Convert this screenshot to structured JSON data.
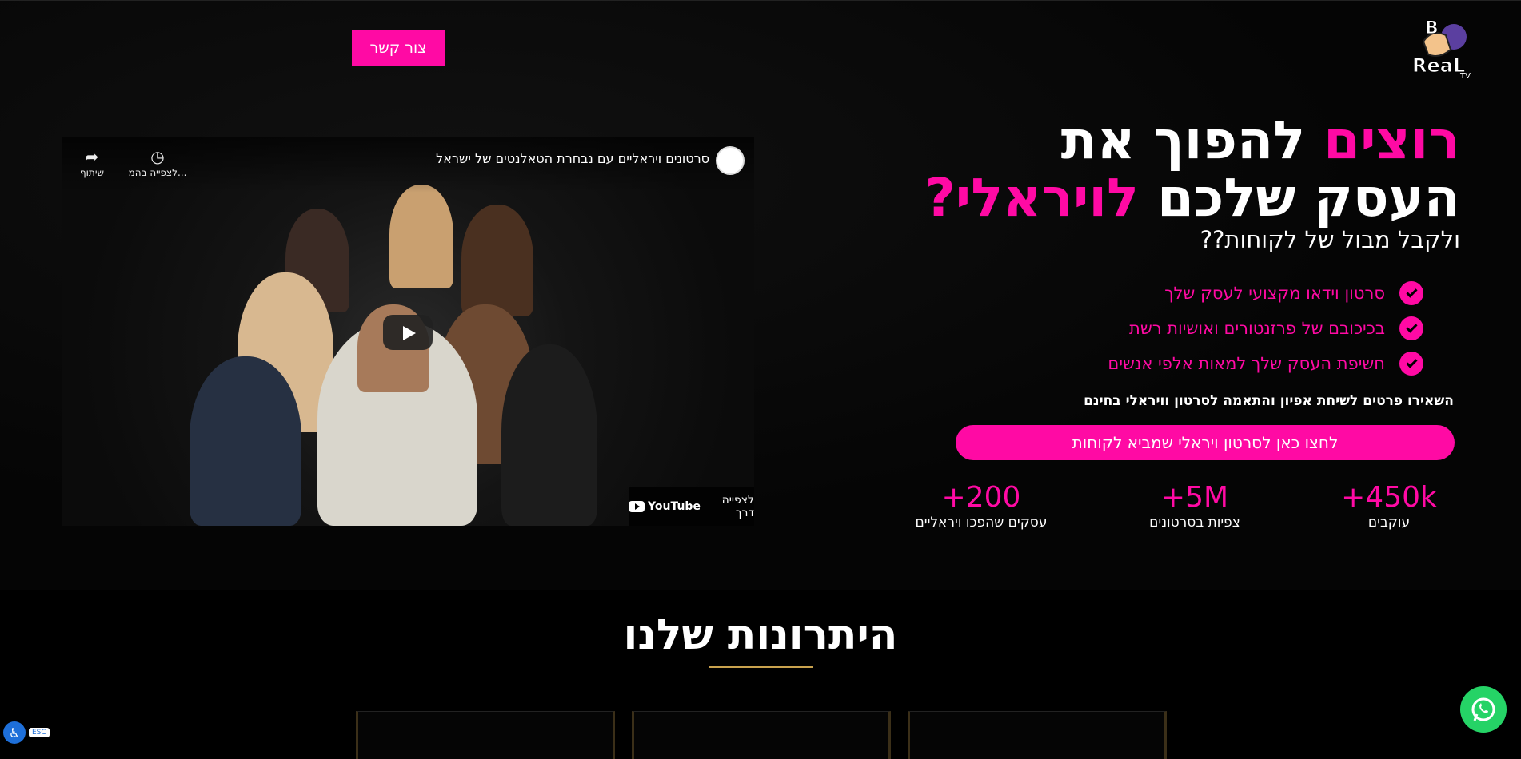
{
  "header": {
    "logo_text": "BReal TV",
    "contact_button": "צור קשר"
  },
  "video": {
    "title": "סרטונים ויראליים עם נבחרת הטאלנטים של ישראל",
    "watch_later": "לצפייה בהמ...",
    "share": "שיתוף",
    "watch_on": "לצפייה דרך",
    "youtube": "YouTube"
  },
  "hero": {
    "headline_pink_1": "רוצים",
    "headline_white_1": " להפוך את",
    "headline_white_2": "העסק שלכם ",
    "headline_pink_2": "לויראלי?",
    "subheadline": "ולקבל מבול של לקוחות??",
    "features": [
      "סרטון וידאו מקצועי לעסק שלך",
      "בכיכובם של פרזנטורים ואושיות רשת",
      "חשיפת העסק שלך למאות אלפי אנשים"
    ],
    "cta_note": "השאירו פרטים לשיחת אפיון והתאמה לסרטון וויראלי בחינם",
    "cta_button": "לחצו כאן לסרטון ויראלי שמביא לקוחות"
  },
  "stats": [
    {
      "value": "+450k",
      "label": "עוקבים"
    },
    {
      "value": "+5M",
      "label": "צפיות בסרטונים"
    },
    {
      "value": "+200",
      "label": "עסקים שהפכו ויראליים"
    }
  ],
  "advantages": {
    "title": "היתרונות שלנו"
  },
  "accessibility": {
    "esc": "ESC"
  },
  "colors": {
    "accent": "#ff0aa4",
    "background": "#000000",
    "divider": "#c9a24e",
    "whatsapp": "#25d366"
  }
}
